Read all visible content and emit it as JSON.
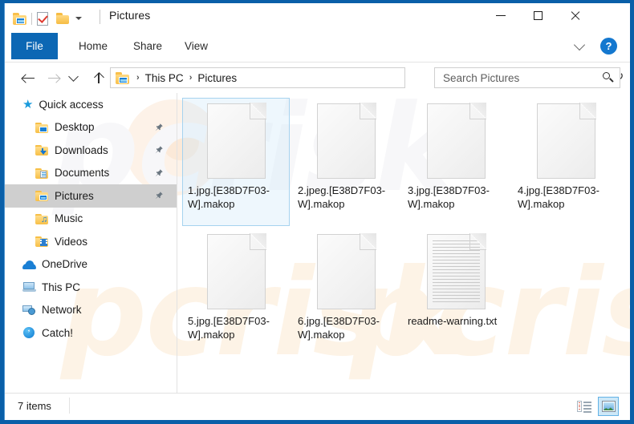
{
  "window": {
    "title": "Pictures",
    "quick_access_icons": [
      "folder-picture-icon",
      "properties-icon",
      "new-folder-icon",
      "customize-chevron-icon"
    ],
    "controls": {
      "minimize": "minimize-icon",
      "maximize": "maximize-icon",
      "close": "close-icon"
    }
  },
  "ribbon": {
    "file_label": "File",
    "tabs": [
      {
        "label": "Home"
      },
      {
        "label": "Share"
      },
      {
        "label": "View"
      }
    ],
    "collapse_label": "chevron-down-icon",
    "help_label": "?"
  },
  "address": {
    "back": "back-arrow-icon",
    "forward": "forward-arrow-icon",
    "recent": "recent-locations-icon",
    "up": "up-arrow-icon",
    "breadcrumb": [
      {
        "label": "This PC"
      },
      {
        "label": "Pictures"
      }
    ],
    "separator": "›",
    "dropdown": "chevron-down-icon",
    "refresh": "↻"
  },
  "search": {
    "placeholder": "Search Pictures",
    "value": "",
    "icon": "search-icon"
  },
  "sidebar": {
    "items": [
      {
        "label": "Quick access",
        "icon": "star-icon",
        "indent": false,
        "pinned": false,
        "selected": false
      },
      {
        "label": "Desktop",
        "icon": "folder-desktop-icon",
        "indent": true,
        "pinned": true,
        "selected": false
      },
      {
        "label": "Downloads",
        "icon": "folder-downloads-icon",
        "indent": true,
        "pinned": true,
        "selected": false
      },
      {
        "label": "Documents",
        "icon": "folder-documents-icon",
        "indent": true,
        "pinned": true,
        "selected": false
      },
      {
        "label": "Pictures",
        "icon": "folder-pictures-icon",
        "indent": true,
        "pinned": true,
        "selected": true
      },
      {
        "label": "Music",
        "icon": "folder-music-icon",
        "indent": true,
        "pinned": false,
        "selected": false
      },
      {
        "label": "Videos",
        "icon": "folder-videos-icon",
        "indent": true,
        "pinned": false,
        "selected": false
      },
      {
        "label": "OneDrive",
        "icon": "cloud-icon",
        "indent": false,
        "pinned": false,
        "selected": false
      },
      {
        "label": "This PC",
        "icon": "computer-icon",
        "indent": false,
        "pinned": false,
        "selected": false
      },
      {
        "label": "Network",
        "icon": "network-icon",
        "indent": false,
        "pinned": false,
        "selected": false
      },
      {
        "label": "Catch!",
        "icon": "catch-icon",
        "indent": false,
        "pinned": false,
        "selected": false
      }
    ]
  },
  "files": [
    {
      "name": "1.jpg.[E38D7F03-W].makop",
      "icon": "blank-file-icon",
      "selected": true
    },
    {
      "name": "2.jpeg.[E38D7F03-W].makop",
      "icon": "blank-file-icon",
      "selected": false
    },
    {
      "name": "3.jpg.[E38D7F03-W].makop",
      "icon": "blank-file-icon",
      "selected": false
    },
    {
      "name": "4.jpg.[E38D7F03-W].makop",
      "icon": "blank-file-icon",
      "selected": false
    },
    {
      "name": "5.jpg.[E38D7F03-W].makop",
      "icon": "blank-file-icon",
      "selected": false
    },
    {
      "name": "6.jpg.[E38D7F03-W].makop",
      "icon": "blank-file-icon",
      "selected": false
    },
    {
      "name": "readme-warning.txt",
      "icon": "text-file-icon",
      "selected": false
    }
  ],
  "status": {
    "count": "7 items",
    "view_details": "details-view-icon",
    "view_icons": "large-icons-view-icon"
  },
  "watermark": {
    "text": "pcrisk"
  },
  "colors": {
    "window_border": "#0a5fa8",
    "file_tab": "#0c67b4",
    "accent": "#1a7fd4",
    "selection_border": "#a6d3ef",
    "sidebar_selected": "#cfcfcf"
  }
}
